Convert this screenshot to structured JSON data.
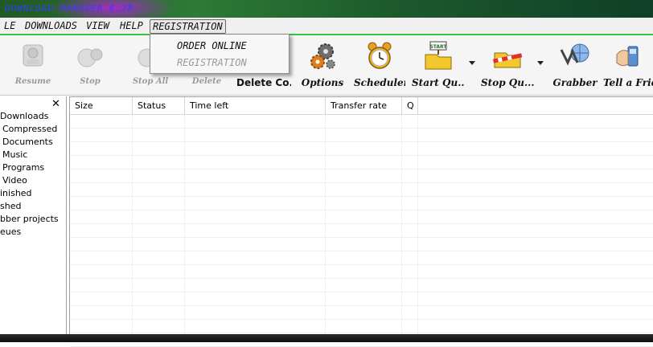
{
  "window": {
    "title": "DOWNLOAD MANAGER 6.28"
  },
  "menubar": {
    "items": [
      {
        "label": "LE",
        "name": "menu-file"
      },
      {
        "label": "DOWNLOADS",
        "name": "menu-downloads"
      },
      {
        "label": "VIEW",
        "name": "menu-view"
      },
      {
        "label": "HELP",
        "name": "menu-help"
      },
      {
        "label": "REGISTRATION",
        "name": "menu-registration"
      }
    ]
  },
  "dropdown": {
    "items": [
      {
        "label": "ORDER ONLINE",
        "enabled": true
      },
      {
        "label": "REGISTRATION",
        "enabled": false
      }
    ]
  },
  "toolbar": {
    "buttons": [
      {
        "label": "Resume",
        "icon": "resume-icon",
        "enabled": false
      },
      {
        "label": "Stop",
        "icon": "stop-icon",
        "enabled": false
      },
      {
        "label": "Stop All",
        "icon": "stop-all-icon",
        "enabled": false
      },
      {
        "label": "Delete",
        "icon": "delete-icon",
        "enabled": false
      },
      {
        "label": "Delete Co...",
        "icon": "delete-completed-icon",
        "enabled": true
      },
      {
        "label": "Options",
        "icon": "gears-icon",
        "enabled": true
      },
      {
        "label": "Scheduler",
        "icon": "alarm-clock-icon",
        "enabled": true
      },
      {
        "label": "Start Qu...",
        "icon": "start-queue-icon",
        "enabled": true
      },
      {
        "label": "Stop Qu...",
        "icon": "stop-queue-icon",
        "enabled": true
      },
      {
        "label": "Grabber",
        "icon": "grabber-icon",
        "enabled": true
      },
      {
        "label": "Tell a Frie...",
        "icon": "phone-icon",
        "enabled": true
      }
    ]
  },
  "sidebar": {
    "items": [
      {
        "label": "Downloads",
        "indent": 0
      },
      {
        "label": "Compressed",
        "indent": 1
      },
      {
        "label": "Documents",
        "indent": 1
      },
      {
        "label": "Music",
        "indent": 1
      },
      {
        "label": "Programs",
        "indent": 1
      },
      {
        "label": "Video",
        "indent": 1
      },
      {
        "label": "inished",
        "indent": 0
      },
      {
        "label": "shed",
        "indent": 0
      },
      {
        "label": "bber projects",
        "indent": 0
      },
      {
        "label": "eues",
        "indent": 0
      }
    ]
  },
  "table": {
    "columns": [
      "Size",
      "Status",
      "Time left",
      "Transfer rate",
      "Q"
    ]
  },
  "colors": {
    "menubar_border": "#3fbf3f",
    "title_text": "#3a3aff"
  }
}
